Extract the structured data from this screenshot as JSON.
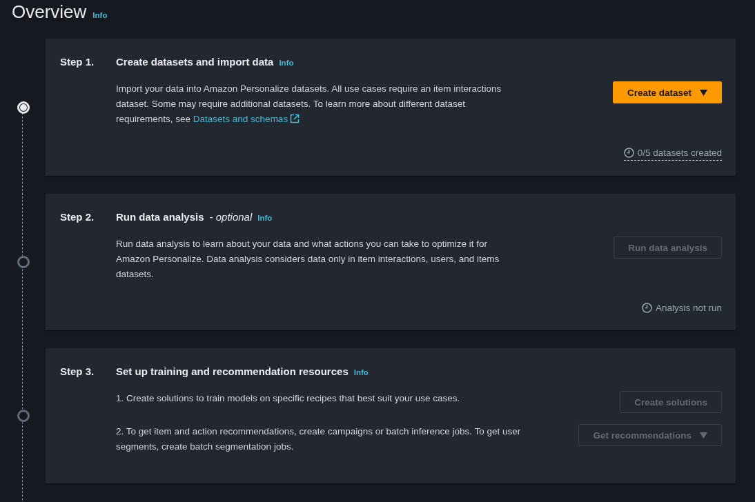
{
  "header": {
    "title": "Overview",
    "info": "Info"
  },
  "steps": [
    {
      "current": true,
      "label": "Step 1.",
      "title": "Create datasets and import data",
      "info": "Info",
      "rows": [
        {
          "text": "Import your data into Amazon Personalize datasets. All use cases require an item interactions dataset. Some may require additional datasets. To learn more about different dataset requirements, see ",
          "link": "Datasets and schemas",
          "button": {
            "label": "Create dataset",
            "kind": "primary",
            "disabled": false,
            "dropdown": true
          }
        }
      ],
      "status": {
        "text": "0/5 datasets created",
        "kind": "popover"
      }
    },
    {
      "current": false,
      "label": "Step 2.",
      "title": "Run data analysis",
      "suffix": "- optional",
      "info": "Info",
      "rows": [
        {
          "text": "Run data analysis to learn about your data and what actions you can take to optimize it for Amazon Personalize. Data analysis considers data only in item interactions, users, and items datasets.",
          "button": {
            "label": "Run data analysis",
            "kind": "normal",
            "disabled": true,
            "dropdown": false
          }
        }
      ],
      "status": {
        "text": "Analysis not run",
        "kind": "plain"
      }
    },
    {
      "current": false,
      "label": "Step 3.",
      "title": "Set up training and recommendation resources",
      "info": "Info",
      "rows": [
        {
          "text": "1. Create solutions to train models on specific recipes that best suit your use cases.",
          "button": {
            "label": "Create solutions",
            "kind": "normal",
            "disabled": true,
            "dropdown": false
          }
        },
        {
          "text": "2. To get item and action recommendations, create campaigns or batch inference jobs. To get user segments, create batch segmentation jobs.",
          "button": {
            "label": "Get recommendations",
            "kind": "normal",
            "disabled": true,
            "dropdown": true
          }
        }
      ]
    }
  ]
}
